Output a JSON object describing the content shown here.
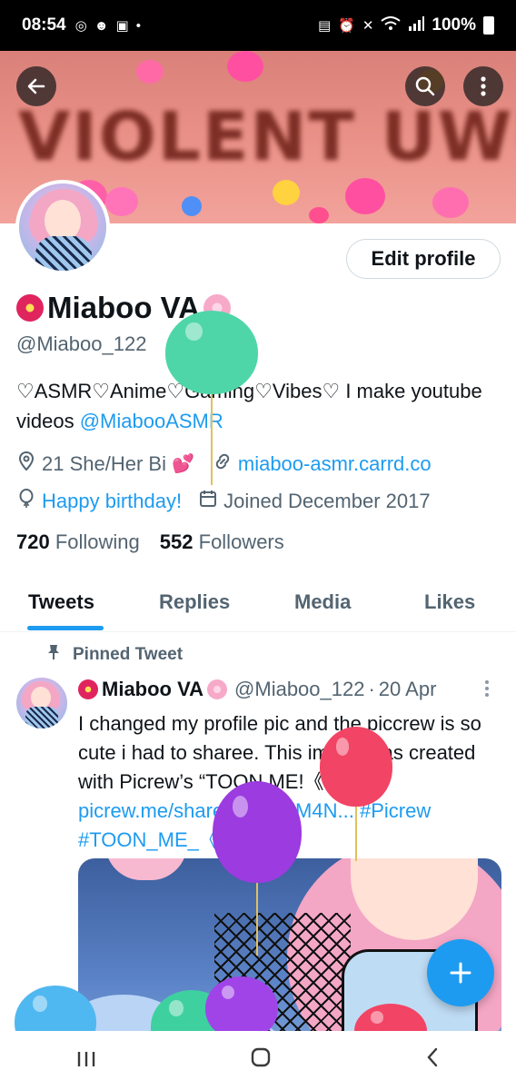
{
  "status_bar": {
    "time": "08:54",
    "battery": "100%",
    "left_icons": [
      "whatsapp-icon",
      "smiley-icon",
      "card-icon",
      "dot-icon"
    ],
    "right_icons": [
      "battery-saver-icon",
      "alarm-icon",
      "mute-icon",
      "wifi-icon",
      "signal-icon",
      "battery-icon"
    ]
  },
  "banner": {
    "text": "VIOLENT UWU"
  },
  "profile": {
    "edit_button": "Edit profile",
    "name": "Miaboo VA",
    "handle": "@Miaboo_122",
    "bio_text": "♡ASMR♡Anime♡Gaming♡Vibes♡ I make youtube videos ",
    "bio_link": "@MiabooASMR",
    "location": "21 She/Her Bi",
    "website": "miaboo-asmr.carrd.co",
    "birthday": "Happy birthday!",
    "joined": "Joined December 2017",
    "following_count": "720",
    "following_label": "Following",
    "followers_count": "552",
    "followers_label": "Followers"
  },
  "tabs": [
    "Tweets",
    "Replies",
    "Media",
    "Likes"
  ],
  "active_tab": "Tweets",
  "tweet": {
    "pinned_label": "Pinned Tweet",
    "author": "Miaboo VA",
    "handle": "@Miaboo_122",
    "separator": "·",
    "date": "20 Apr",
    "text": "I changed my profile pic and the piccrew is so cute i had to sharee. This image was created with Picrew’s “TOON ME!《 A 》“!! ",
    "link": "picrew.me/share?cd=QZM4N...",
    "hashtag1": "#Picrew",
    "hashtag2": "#TOON_ME_《_A_》"
  },
  "colors": {
    "accent": "#1d9bf0",
    "text_primary": "#0f1419",
    "text_secondary": "#536471"
  }
}
